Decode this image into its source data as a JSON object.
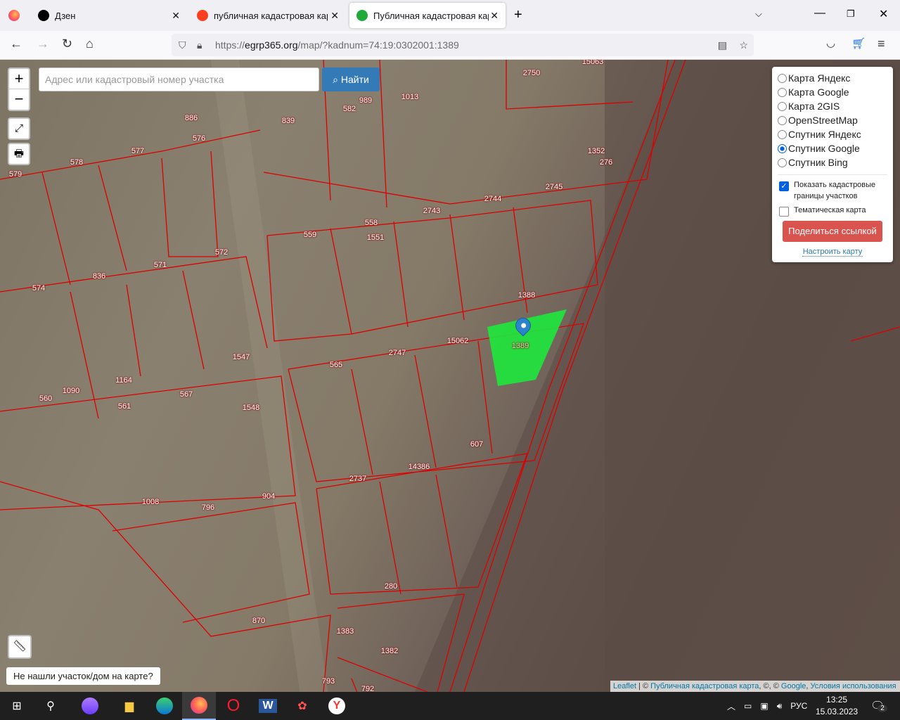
{
  "browser": {
    "tabs": [
      {
        "label": "Дзен"
      },
      {
        "label": "публичная кадастровая карта"
      },
      {
        "label": "Публичная кадастровая карта"
      }
    ],
    "url_prefix": "https://",
    "url_host": "egrp365.org",
    "url_path": "/map/?kadnum=74:19:0302001:1389"
  },
  "map": {
    "search_placeholder": "Адрес или кадастровый номер участка",
    "search_button": "Найти",
    "zoom_in": "+",
    "zoom_out": "−",
    "layers": [
      "Карта Яндекс",
      "Карта Google",
      "Карта 2GIS",
      "OpenStreetMap",
      "Спутник Яндекс",
      "Спутник Google",
      "Спутник Bing"
    ],
    "selected_layer": "Спутник Google",
    "show_cadastral": "Показать кадастровые границы участков",
    "show_cadastral_checked": true,
    "thematic": "Тематическая карта",
    "thematic_checked": false,
    "share_button": "Поделиться ссылкой",
    "configure_link": "Настроить карту",
    "not_found_button": "Не нашли участок/дом на карте?",
    "attribution": {
      "leaflet": "Leaflet",
      "sep": " | © ",
      "pkk": "Публичная кадастровая карта",
      "mid": ", ©, © ",
      "google": "Google",
      "comma": ", ",
      "terms": "Условия использования"
    },
    "selected_parcel": "1389",
    "parcel_labels": [
      "15063",
      "2750",
      "1013",
      "989",
      "582",
      "886",
      "576",
      "839",
      "577",
      "578",
      "579",
      "1352",
      "276",
      "2745",
      "2744",
      "2743",
      "558",
      "1551",
      "559",
      "572",
      "571",
      "836",
      "574",
      "1388",
      "15062",
      "2747",
      "565",
      "1547",
      "1164",
      "1090",
      "560",
      "561",
      "567",
      "1548",
      "607",
      "14386",
      "2737",
      "1008",
      "796",
      "904",
      "280",
      "870",
      "1383",
      "1382",
      "793",
      "792"
    ]
  },
  "taskbar": {
    "lang": "РУС",
    "time": "13:25",
    "date": "15.03.2023",
    "notifications": "2"
  }
}
